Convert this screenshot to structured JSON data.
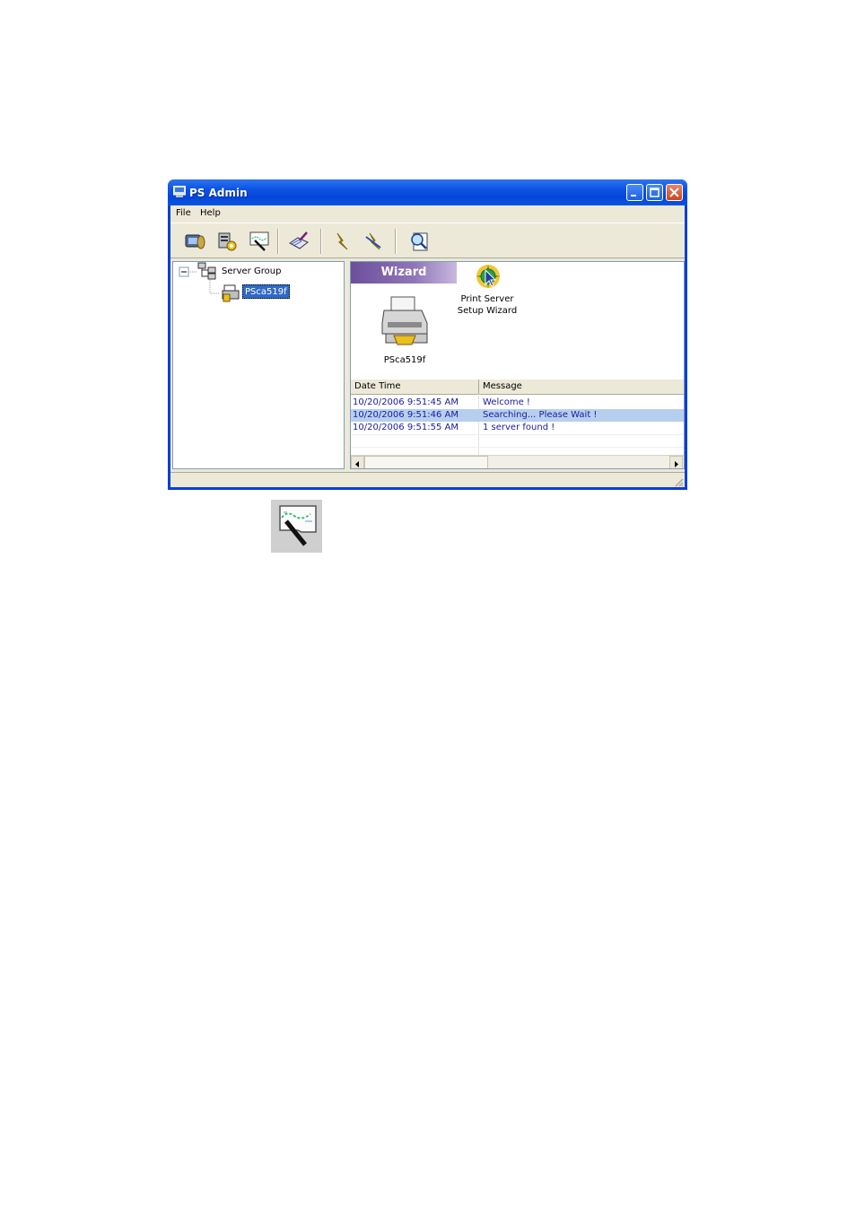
{
  "window": {
    "title": "PS Admin",
    "buttons": [
      "minimize-icon",
      "maximize-icon",
      "close-icon"
    ]
  },
  "menu": {
    "items": [
      "File",
      "Help"
    ]
  },
  "toolbar": {
    "tools": [
      "search-server-icon",
      "server-settings-icon",
      "wizard-icon",
      "configure-icon",
      "connect-icon",
      "disconnect-icon",
      "find-icon"
    ]
  },
  "tree": {
    "group_label": "Server Group",
    "server_label": "PSca519f"
  },
  "wizard": {
    "header": "Wizard",
    "printer_label": "PSca519f",
    "setup_line1": "Print Server",
    "setup_line2": "Setup Wizard"
  },
  "log": {
    "columns": [
      "Date Time",
      "Message"
    ],
    "rows": [
      {
        "time": "10/20/2006 9:51:45 AM",
        "message": "Welcome !"
      },
      {
        "time": "10/20/2006 9:51:46 AM",
        "message": "Searching... Please Wait !"
      },
      {
        "time": "10/20/2006 9:51:55 AM",
        "message": "1 server found !"
      }
    ],
    "selected_row": 1
  },
  "colors": {
    "title_bar": "#0346d8",
    "selection": "#316ac5",
    "log_text": "#1a1aa0",
    "wizard_header": "#6c4f9a"
  }
}
